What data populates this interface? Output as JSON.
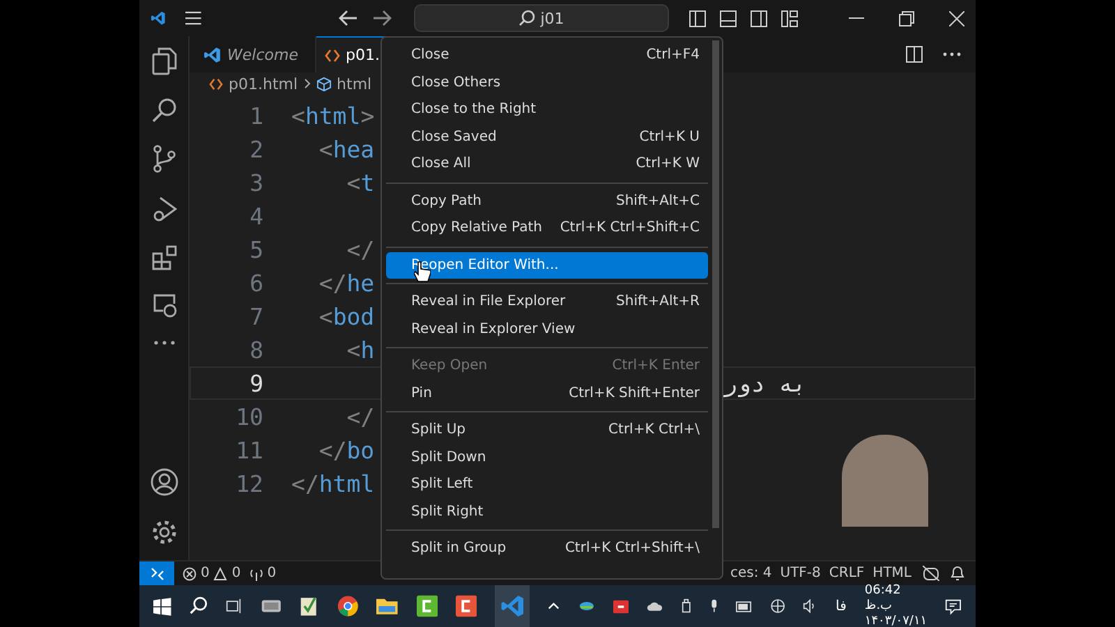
{
  "title_bar": {
    "search": "j01"
  },
  "tabs": [
    {
      "label": "Welcome",
      "selected": false
    },
    {
      "label": "p01.",
      "selected": true
    }
  ],
  "breadcrumbs": [
    "p01.html",
    "html"
  ],
  "code_lines": [
    {
      "number": "1",
      "text": "<html>",
      "current": false
    },
    {
      "number": "2",
      "text": "  <hea",
      "current": false
    },
    {
      "number": "3",
      "text": "    <t",
      "current": false
    },
    {
      "number": "4",
      "current": false
    },
    {
      "number": "5",
      "text": "    </",
      "current": false
    },
    {
      "number": "6",
      "text": "  </he",
      "current": false
    },
    {
      "number": "7",
      "text": "  <bod",
      "current": false
    },
    {
      "number": "8",
      "text": "    <h",
      "current": false
    },
    {
      "number": "9",
      "current": true,
      "trailing_text": "به دور"
    },
    {
      "number": "10",
      "text": "    </",
      "current": false
    },
    {
      "number": "11",
      "text": "  </bo",
      "current": false
    },
    {
      "number": "12",
      "text": "</html",
      "current": false
    }
  ],
  "context_menu": {
    "groups": [
      [
        {
          "label": "Close",
          "shortcut": "Ctrl+F4",
          "disabled": false,
          "selected": false
        },
        {
          "label": "Close Others",
          "disabled": false,
          "selected": false
        },
        {
          "label": "Close to the Right",
          "disabled": false,
          "selected": false
        },
        {
          "label": "Close Saved",
          "shortcut": "Ctrl+K U",
          "disabled": false,
          "selected": false
        },
        {
          "label": "Close All",
          "shortcut": "Ctrl+K W",
          "disabled": false,
          "selected": false
        }
      ],
      [
        {
          "label": "Copy Path",
          "shortcut": "Shift+Alt+C",
          "disabled": false,
          "selected": false
        },
        {
          "label": "Copy Relative Path",
          "shortcut": "Ctrl+K Ctrl+Shift+C",
          "disabled": false,
          "selected": false
        }
      ],
      [
        {
          "label": "Reopen Editor With...",
          "disabled": false,
          "selected": true
        }
      ],
      [
        {
          "label": "Reveal in File Explorer",
          "shortcut": "Shift+Alt+R",
          "disabled": false,
          "selected": false
        },
        {
          "label": "Reveal in Explorer View",
          "disabled": false,
          "selected": false
        }
      ],
      [
        {
          "label": "Keep Open",
          "shortcut": "Ctrl+K Enter",
          "disabled": true,
          "selected": false
        },
        {
          "label": "Pin",
          "shortcut": "Ctrl+K Shift+Enter",
          "disabled": false,
          "selected": false
        }
      ],
      [
        {
          "label": "Split Up",
          "shortcut": "Ctrl+K Ctrl+\\",
          "disabled": false,
          "selected": false
        },
        {
          "label": "Split Down",
          "disabled": false,
          "selected": false
        },
        {
          "label": "Split Left",
          "disabled": false,
          "selected": false
        },
        {
          "label": "Split Right",
          "disabled": false,
          "selected": false
        }
      ],
      [
        {
          "label": "Split in Group",
          "shortcut": "Ctrl+K Ctrl+Shift+\\",
          "disabled": false,
          "selected": false
        }
      ]
    ]
  },
  "status_bar": {
    "errors": "0",
    "warnings": "0",
    "ports": "0",
    "items": [
      "ces: 4",
      "UTF-8",
      "CRLF",
      "HTML"
    ]
  },
  "taskbar": {
    "language": "فا",
    "time": "06:42 ب.ظ",
    "date": "۱۴۰۳/۰۷/۱۱"
  }
}
